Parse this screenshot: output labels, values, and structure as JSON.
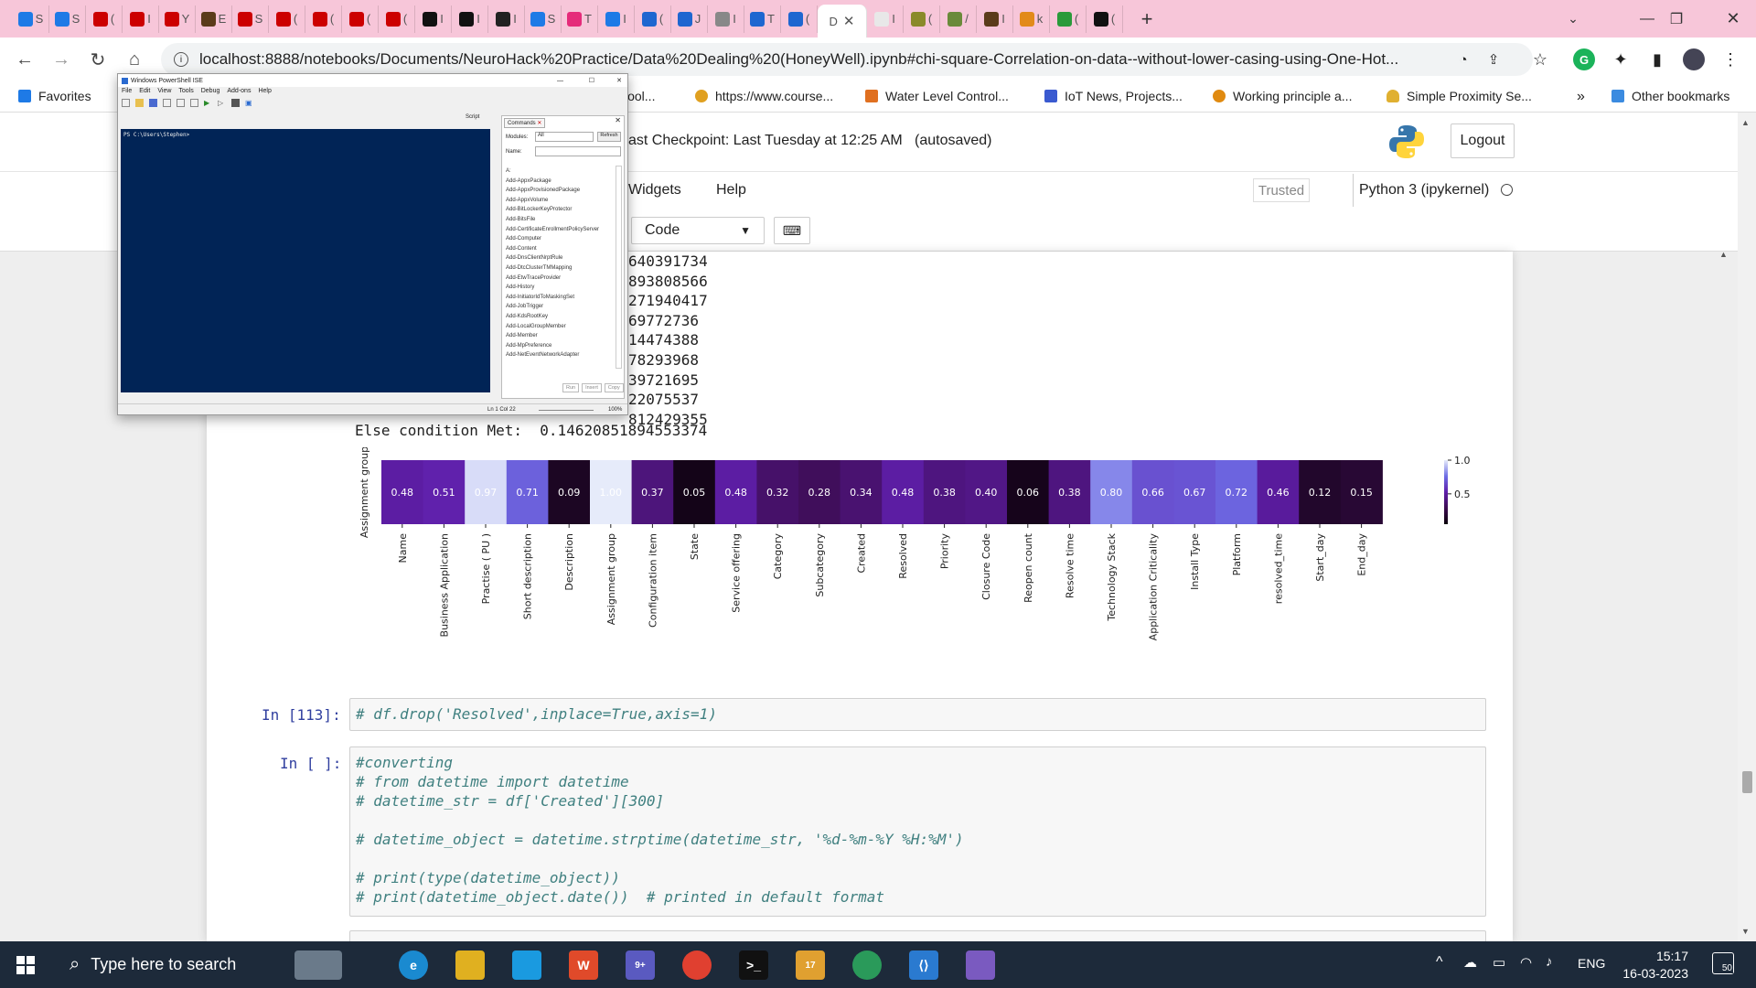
{
  "browser": {
    "tabs": [
      {
        "label": "S",
        "color": "#1e7ae6"
      },
      {
        "label": "S",
        "color": "#1e7ae6"
      },
      {
        "label": "(",
        "color": "#cc0000"
      },
      {
        "label": "I",
        "color": "#cc0000"
      },
      {
        "label": "Y",
        "color": "#cc0000"
      },
      {
        "label": "E",
        "color": "#5b3b1a"
      },
      {
        "label": "S",
        "color": "#cc0000"
      },
      {
        "label": "(",
        "color": "#cc0000"
      },
      {
        "label": "(",
        "color": "#cc0000"
      },
      {
        "label": "(",
        "color": "#cc0000"
      },
      {
        "label": "(",
        "color": "#cc0000"
      },
      {
        "label": "I",
        "color": "#111111"
      },
      {
        "label": "I",
        "color": "#111111"
      },
      {
        "label": "I",
        "color": "#222222"
      },
      {
        "label": "S",
        "color": "#1e7ae6"
      },
      {
        "label": "T",
        "color": "#e52b7a"
      },
      {
        "label": "I",
        "color": "#1e7ae6"
      },
      {
        "label": "(",
        "color": "#1e66d0"
      },
      {
        "label": "J",
        "color": "#1e66d0"
      },
      {
        "label": "I",
        "color": "#888888"
      },
      {
        "label": "T",
        "color": "#1e66d0"
      },
      {
        "label": "(",
        "color": "#1e66d0"
      }
    ],
    "active_tab_label": "D",
    "after_tabs": [
      {
        "label": "I",
        "color": "#e8e8e8"
      },
      {
        "label": "(",
        "color": "#8a8a2a"
      },
      {
        "label": "/",
        "color": "#6a8a3a"
      },
      {
        "label": "I",
        "color": "#5b3b1a"
      },
      {
        "label": "k",
        "color": "#e28a1a"
      },
      {
        "label": "(",
        "color": "#2a9a3a"
      },
      {
        "label": "(",
        "color": "#111111"
      }
    ],
    "url": "localhost:8888/notebooks/Documents/NeuroHack%20Practice/Data%20Dealing%20(HoneyWell).ipynb#chi-square-Correlation-on-data--without-lower-casing-using-One-Hot...",
    "bookmarks": [
      {
        "label": "Favorites",
        "color": "#1e7ae6"
      },
      {
        "label": "Cool...",
        "color": "#999999"
      },
      {
        "label": "https://www.course...",
        "color": "#e0a020"
      },
      {
        "label": "Water Level Control...",
        "color": "#e07020"
      },
      {
        "label": "IoT News, Projects...",
        "color": "#3a5ad0"
      },
      {
        "label": "Working principle a...",
        "color": "#e08a10"
      },
      {
        "label": "Simple Proximity Se...",
        "color": "#e0b030"
      }
    ],
    "bookmarks_more": "»",
    "other_bookmarks": "Other bookmarks"
  },
  "jupyter": {
    "checkpoint": "ast Checkpoint: Last Tuesday at 12:25 AM",
    "autosaved": "(autosaved)",
    "logout": "Logout",
    "menu_widgets": "Widgets",
    "menu_help": "Help",
    "trusted": "Trusted",
    "kernel": "Python 3 (ipykernel)",
    "cell_type": "Code"
  },
  "output": {
    "numbers": [
      "640391734",
      "893808566",
      "271940417",
      "69772736",
      "14474388",
      "78293968",
      "39721695",
      "22075537",
      "812429355"
    ],
    "else_line": "Else condition Met:  0.14620851894553374"
  },
  "chart_data": {
    "type": "heatmap",
    "ylabel": "Assignment group",
    "rows": [
      "Assignment group"
    ],
    "columns": [
      "Name",
      "Business Application",
      "Practise ( PU )",
      "Short description",
      "Description",
      "Assignment group",
      "Configuration item",
      "State",
      "Service offering",
      "Category",
      "Subcategory",
      "Created",
      "Resolved",
      "Priority",
      "Closure Code",
      "Reopen count",
      "Resolve time",
      "Technology Stack",
      "Application Criticality",
      "Install Type",
      "Platform",
      "resolved_time",
      "Start_day",
      "End_day"
    ],
    "values": [
      [
        0.48,
        0.51,
        0.97,
        0.71,
        0.09,
        1.0,
        0.37,
        0.05,
        0.48,
        0.32,
        0.28,
        0.34,
        0.48,
        0.38,
        0.4,
        0.06,
        0.38,
        0.8,
        0.66,
        0.67,
        0.72,
        0.46,
        0.12,
        0.15
      ]
    ],
    "value_labels": [
      "0.48",
      "0.51",
      "0.97",
      "0.71",
      "0.09",
      "1.00",
      "0.37",
      "0.05",
      "0.48",
      "0.32",
      "0.28",
      "0.34",
      "0.48",
      "0.38",
      "0.40",
      "0.06",
      "0.38",
      "0.80",
      "0.66",
      "0.67",
      "0.72",
      "0.46",
      "0.12",
      "0.15"
    ],
    "colorbar_ticks": [
      "1.0",
      "0.5"
    ],
    "colormap": "magma-purple"
  },
  "cells": [
    {
      "prompt": "In [113]:",
      "lines": [
        "# df.drop('Resolved',inplace=True,axis=1)"
      ]
    },
    {
      "prompt": "In [ ]:",
      "lines": [
        "#converting",
        "# from datetime import datetime",
        "# datetime_str = df['Created'][300]",
        "",
        "# datetime_object = datetime.strptime(datetime_str, '%d-%m-%Y %H:%M')",
        "",
        "# print(type(datetime_object))",
        "# print(datetime_object.date())  # printed in default format"
      ]
    }
  ],
  "ise": {
    "title": "Windows PowerShell ISE",
    "menus": [
      "File",
      "Edit",
      "View",
      "Tools",
      "Debug",
      "Add-ons",
      "Help"
    ],
    "script_label": "Script",
    "prompt": "PS C:\\Users\\Stephen>",
    "commands_tab": "Commands",
    "modules_label": "Modules:",
    "modules_value": "All",
    "refresh": "Refresh",
    "name_label": "Name:",
    "commands": [
      "A:",
      "Add-AppxPackage",
      "Add-AppxProvisionedPackage",
      "Add-AppxVolume",
      "Add-BitLockerKeyProtector",
      "Add-BitsFile",
      "Add-CertificateEnrollmentPolicyServer",
      "Add-Computer",
      "Add-Content",
      "Add-DnsClientNrptRule",
      "Add-DtcClusterTMMapping",
      "Add-EtwTraceProvider",
      "Add-History",
      "Add-InitiatorIdToMaskingSet",
      "Add-JobTrigger",
      "Add-KdsRootKey",
      "Add-LocalGroupMember",
      "Add-Member",
      "Add-MpPreference",
      "Add-NetEventNetworkAdapter"
    ],
    "run": "Run",
    "insert": "Insert",
    "copy": "Copy",
    "status": "Ln 1  Col 22",
    "zoom": "100%"
  },
  "taskbar": {
    "search_placeholder": "Type here to search",
    "lang": "ENG",
    "time": "15:17",
    "date": "16-03-2023",
    "notif_count": "50",
    "mail_badge": "17",
    "teams_badge": "9+"
  },
  "colors": {
    "jupyter_prompt": "#303F9F",
    "code_comment": "#408080",
    "console_bg": "#012456",
    "taskbar_bg": "#1d2a3a"
  }
}
